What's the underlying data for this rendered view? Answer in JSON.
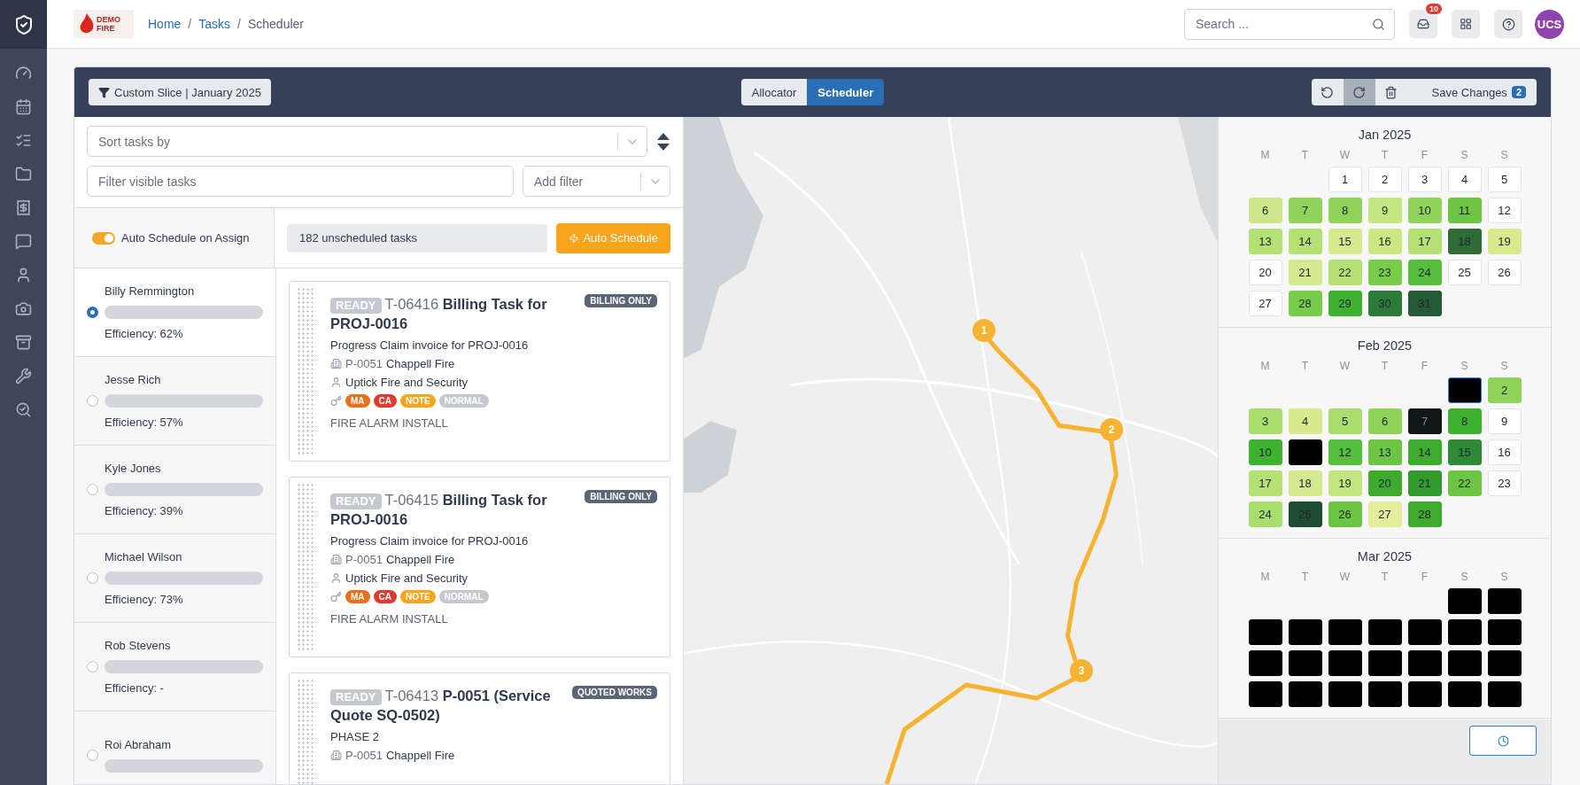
{
  "header": {
    "logo": {
      "line1": "DEMO",
      "line2": "FIRE"
    },
    "breadcrumbs": [
      {
        "label": "Home",
        "link": true
      },
      {
        "label": "Tasks",
        "link": true
      },
      {
        "label": "Scheduler",
        "link": false
      }
    ],
    "separator": "/",
    "search": {
      "placeholder": "Search ..."
    },
    "notifications": "10",
    "avatar": "UCS"
  },
  "toolbar": {
    "slice": "Custom Slice | January 2025",
    "views": [
      {
        "label": "Allocator",
        "selected": false
      },
      {
        "label": "Scheduler",
        "selected": true
      }
    ],
    "actions": [
      {
        "kind": "undo",
        "disabled": false
      },
      {
        "kind": "redo",
        "disabled": true
      },
      {
        "kind": "delete",
        "disabled": false
      }
    ],
    "save": {
      "label": "Save Changes",
      "count": "2"
    }
  },
  "filters": {
    "sort": {
      "placeholder": "Sort tasks by"
    },
    "search": {
      "placeholder": "Filter visible tasks"
    },
    "add_filter": {
      "placeholder": "Add filter"
    }
  },
  "auto": {
    "toggle": {
      "label": "Auto Schedule on Assign",
      "on": true
    },
    "unscheduled": "182 unscheduled tasks",
    "button": "Auto Schedule"
  },
  "technicians": [
    {
      "name": "Billy Remmington",
      "efficiency": "Efficiency: 62%",
      "selected": true
    },
    {
      "name": "Jesse Rich",
      "efficiency": "Efficiency: 57%",
      "selected": false
    },
    {
      "name": "Kyle Jones",
      "efficiency": "Efficiency: 39%",
      "selected": false
    },
    {
      "name": "Michael Wilson",
      "efficiency": "Efficiency: 73%",
      "selected": false
    },
    {
      "name": "Rob Stevens",
      "efficiency": "Efficiency: -",
      "selected": false
    },
    {
      "name": "Roi Abraham",
      "selected": false
    }
  ],
  "tasks": [
    {
      "status": "READY",
      "id": "T-06416",
      "title": "Billing Task for PROJ-0016",
      "type": "BILLING ONLY",
      "description": "Progress Claim invoice for PROJ-0016",
      "project_code": "P-0051",
      "project_name": "Chappell Fire",
      "client": "Uptick Fire and Security",
      "badges": [
        {
          "label": "MA",
          "color": "#e8711c"
        },
        {
          "label": "CA",
          "color": "#e03a2f"
        },
        {
          "label": "NOTE",
          "color": "#f6a51c"
        },
        {
          "label": "NORMAL",
          "color": "#c5c9cf"
        }
      ],
      "category": "FIRE ALARM INSTALL"
    },
    {
      "status": "READY",
      "id": "T-06415",
      "title": "Billing Task for PROJ-0016",
      "type": "BILLING ONLY",
      "description": "Progress Claim invoice for PROJ-0016",
      "project_code": "P-0051",
      "project_name": "Chappell Fire",
      "client": "Uptick Fire and Security",
      "badges": [
        {
          "label": "MA",
          "color": "#e8711c"
        },
        {
          "label": "CA",
          "color": "#e03a2f"
        },
        {
          "label": "NOTE",
          "color": "#f6a51c"
        },
        {
          "label": "NORMAL",
          "color": "#c5c9cf"
        }
      ],
      "category": "FIRE ALARM INSTALL"
    },
    {
      "status": "READY",
      "id": "T-06413",
      "title": "P-0051 (Service Quote SQ-0502)",
      "type": "QUOTED WORKS",
      "description": "PHASE 2",
      "project_code": "P-0051",
      "project_name": "Chappell Fire"
    }
  ],
  "map": {
    "kind": "picture",
    "route_stops": [
      "1",
      "2",
      "3"
    ]
  },
  "calendar": {
    "months": [
      {
        "title": "Jan 2025",
        "weekdays": [
          "M",
          "T",
          "W",
          "T",
          "F",
          "S",
          "S"
        ],
        "days": [
          {
            "kind": "blank"
          },
          {
            "kind": "blank"
          },
          {
            "kind": "day",
            "label": "1",
            "color": "#ffffff",
            "selected": false
          },
          {
            "kind": "day",
            "label": "2",
            "color": "#ffffff",
            "selected": false
          },
          {
            "kind": "day",
            "label": "3",
            "color": "#ffffff",
            "selected": false
          },
          {
            "kind": "day",
            "label": "4",
            "color": "#ffffff",
            "selected": false
          },
          {
            "kind": "day",
            "label": "5",
            "color": "#ffffff",
            "selected": false
          },
          {
            "kind": "day",
            "label": "6",
            "color": "#cde68a",
            "selected": false
          },
          {
            "kind": "day",
            "label": "7",
            "color": "#8fd35a",
            "selected": false
          },
          {
            "kind": "day",
            "label": "8",
            "color": "#8fd35a",
            "selected": false
          },
          {
            "kind": "day",
            "label": "9",
            "color": "#c5e57f",
            "selected": false
          },
          {
            "kind": "day",
            "label": "10",
            "color": "#8fd35a",
            "selected": false
          },
          {
            "kind": "day",
            "label": "11",
            "color": "#6cc644",
            "selected": false
          },
          {
            "kind": "day",
            "label": "12",
            "color": "#ffffff",
            "selected": false
          },
          {
            "kind": "day",
            "label": "13",
            "color": "#b5e073",
            "selected": false
          },
          {
            "kind": "day",
            "label": "14",
            "color": "#b5e073",
            "selected": false
          },
          {
            "kind": "day",
            "label": "15",
            "color": "#d4ea8e",
            "selected": false
          },
          {
            "kind": "day",
            "label": "16",
            "color": "#cce784",
            "selected": false
          },
          {
            "kind": "day",
            "label": "17",
            "color": "#b5e073",
            "selected": false
          },
          {
            "kind": "day",
            "label": "18",
            "color": "#2e6b36",
            "selected": false
          },
          {
            "kind": "day",
            "label": "19",
            "color": "#d9ea8e",
            "selected": false
          },
          {
            "kind": "day",
            "label": "20",
            "color": "#ffffff",
            "selected": false
          },
          {
            "kind": "day",
            "label": "21",
            "color": "#d4ea8e",
            "selected": false
          },
          {
            "kind": "day",
            "label": "22",
            "color": "#b5e073",
            "selected": false
          },
          {
            "kind": "day",
            "label": "23",
            "color": "#78cc4a",
            "selected": false
          },
          {
            "kind": "day",
            "label": "24",
            "color": "#55bf3c",
            "selected": false
          },
          {
            "kind": "day",
            "label": "25",
            "color": "#ffffff",
            "selected": false
          },
          {
            "kind": "day",
            "label": "26",
            "color": "#ffffff",
            "selected": false
          },
          {
            "kind": "day",
            "label": "27",
            "color": "#ffffff",
            "selected": false
          },
          {
            "kind": "day",
            "label": "28",
            "color": "#78cc4a",
            "selected": false
          },
          {
            "kind": "day",
            "label": "29",
            "color": "#3eb22e",
            "selected": false
          },
          {
            "kind": "day",
            "label": "30",
            "color": "#2e7a39",
            "selected": false
          },
          {
            "kind": "day",
            "label": "31",
            "color": "#245a35",
            "selected": false
          }
        ]
      },
      {
        "title": "Feb 2025",
        "weekdays": [
          "M",
          "T",
          "W",
          "T",
          "F",
          "S",
          "S"
        ],
        "days": [
          {
            "kind": "blank"
          },
          {
            "kind": "blank"
          },
          {
            "kind": "blank"
          },
          {
            "kind": "blank"
          },
          {
            "kind": "blank"
          },
          {
            "kind": "day",
            "color": "#000000",
            "selected": true
          },
          {
            "kind": "day",
            "label": "2",
            "color": "#8fd35a",
            "selected": false
          },
          {
            "kind": "day",
            "label": "3",
            "color": "#a9dd6d",
            "selected": false
          },
          {
            "kind": "day",
            "label": "4",
            "color": "#d9ea8e",
            "selected": false
          },
          {
            "kind": "day",
            "label": "5",
            "color": "#a9dd6d",
            "selected": false
          },
          {
            "kind": "day",
            "label": "6",
            "color": "#8fd35a",
            "selected": false
          },
          {
            "kind": "day",
            "label": "7",
            "color": "#111716",
            "selected": false
          },
          {
            "kind": "day",
            "label": "8",
            "color": "#3eb22e",
            "selected": false
          },
          {
            "kind": "day",
            "label": "9",
            "color": "#ffffff",
            "selected": false
          },
          {
            "kind": "day",
            "label": "10",
            "color": "#3eb22e",
            "selected": false
          },
          {
            "kind": "day",
            "color": "#000000",
            "selected": false
          },
          {
            "kind": "day",
            "label": "12",
            "color": "#55bf3c",
            "selected": false
          },
          {
            "kind": "day",
            "label": "13",
            "color": "#6cc644",
            "selected": false
          },
          {
            "kind": "day",
            "label": "14",
            "color": "#3eaa2e",
            "selected": false
          },
          {
            "kind": "day",
            "label": "15",
            "color": "#2e8a36",
            "selected": false
          },
          {
            "kind": "day",
            "label": "16",
            "color": "#ffffff",
            "selected": false
          },
          {
            "kind": "day",
            "label": "17",
            "color": "#b5e073",
            "selected": false
          },
          {
            "kind": "day",
            "label": "18",
            "color": "#d4ea8e",
            "selected": false
          },
          {
            "kind": "day",
            "label": "19",
            "color": "#c5e57f",
            "selected": false
          },
          {
            "kind": "day",
            "label": "20",
            "color": "#3eaa2e",
            "selected": false
          },
          {
            "kind": "day",
            "label": "21",
            "color": "#339a30",
            "selected": false
          },
          {
            "kind": "day",
            "label": "22",
            "color": "#6cc644",
            "selected": false
          },
          {
            "kind": "day",
            "label": "23",
            "color": "#ffffff",
            "selected": false
          },
          {
            "kind": "day",
            "label": "24",
            "color": "#a9dd6d",
            "selected": false
          },
          {
            "kind": "day",
            "label": "25",
            "color": "#1f4d33",
            "selected": false
          },
          {
            "kind": "day",
            "label": "26",
            "color": "#6cc644",
            "selected": false
          },
          {
            "kind": "day",
            "label": "27",
            "color": "#e4ee9a",
            "selected": false
          },
          {
            "kind": "day",
            "label": "28",
            "color": "#3eaa2e",
            "selected": false
          }
        ]
      },
      {
        "title": "Mar 2025",
        "weekdays": [
          "M",
          "T",
          "W",
          "T",
          "F",
          "S",
          "S"
        ],
        "days": [
          {
            "kind": "blank"
          },
          {
            "kind": "blank"
          },
          {
            "kind": "blank"
          },
          {
            "kind": "blank"
          },
          {
            "kind": "blank"
          },
          {
            "kind": "day",
            "color": "#000000",
            "selected": false
          },
          {
            "kind": "day",
            "color": "#000000",
            "selected": false
          },
          {
            "kind": "day",
            "color": "#000000",
            "selected": false
          },
          {
            "kind": "day",
            "color": "#000000",
            "selected": false
          },
          {
            "kind": "day",
            "color": "#000000",
            "selected": false
          },
          {
            "kind": "day",
            "color": "#000000",
            "selected": false
          },
          {
            "kind": "day",
            "color": "#000000",
            "selected": false
          },
          {
            "kind": "day",
            "color": "#000000",
            "selected": false
          },
          {
            "kind": "day",
            "color": "#000000",
            "selected": false
          },
          {
            "kind": "day",
            "color": "#000000",
            "selected": false
          },
          {
            "kind": "day",
            "color": "#000000",
            "selected": false
          },
          {
            "kind": "day",
            "color": "#000000",
            "selected": false
          },
          {
            "kind": "day",
            "color": "#000000",
            "selected": false
          },
          {
            "kind": "day",
            "color": "#000000",
            "selected": false
          },
          {
            "kind": "day",
            "color": "#000000",
            "selected": false
          },
          {
            "kind": "day",
            "color": "#000000",
            "selected": false
          },
          {
            "kind": "day",
            "color": "#000000",
            "selected": false
          },
          {
            "kind": "day",
            "color": "#000000",
            "selected": false
          },
          {
            "kind": "day",
            "color": "#000000",
            "selected": false
          },
          {
            "kind": "day",
            "color": "#000000",
            "selected": false
          },
          {
            "kind": "day",
            "color": "#000000",
            "selected": false
          },
          {
            "kind": "day",
            "color": "#000000",
            "selected": false
          },
          {
            "kind": "day",
            "color": "#000000",
            "selected": false
          }
        ]
      }
    ]
  }
}
